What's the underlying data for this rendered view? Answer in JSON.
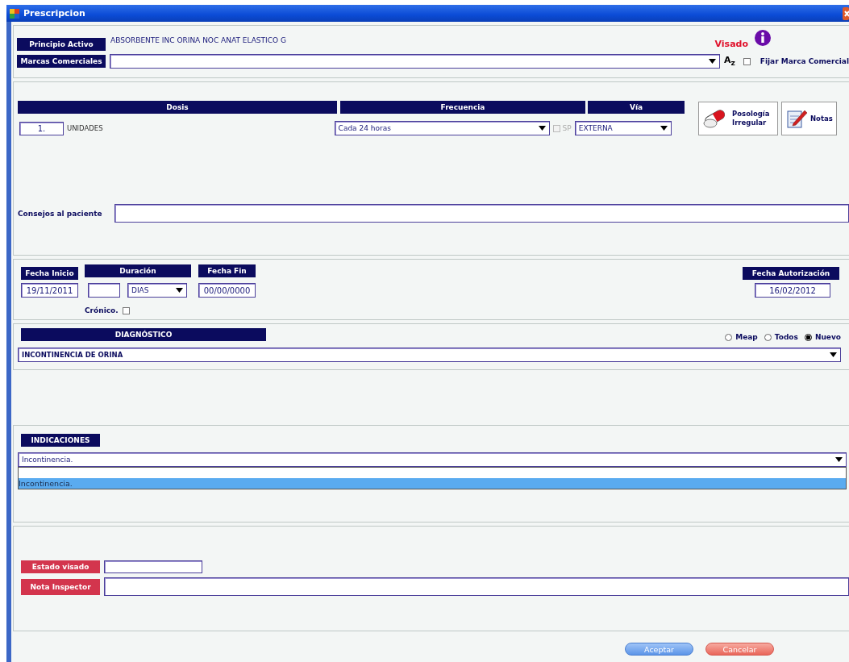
{
  "window": {
    "title": "Prescripcion"
  },
  "principio_activo": {
    "label": "Principio Activo",
    "value": "ABSORBENTE INC ORINA NOC ANAT ELASTICO G"
  },
  "visado": {
    "label": "Visado"
  },
  "marcas_comerciales": {
    "label": "Marcas Comerciales",
    "sort_label": "A$_{z}$",
    "fijar": {
      "label": "Fijar Marca Comercial",
      "checked": false
    }
  },
  "dosis": {
    "header": "Dosis",
    "value": "1.",
    "unit": "UNIDADES"
  },
  "frecuencia": {
    "header": "Frecuencia",
    "value": "Cada 24 horas",
    "sp": {
      "label": "SP",
      "checked": false,
      "disabled": true
    }
  },
  "via": {
    "header": "Vía",
    "value": "EXTERNA"
  },
  "side_buttons": [
    {
      "label": "Posología Irregular",
      "kind": "pills"
    },
    {
      "label": "Notas",
      "kind": "notes"
    }
  ],
  "consejos": {
    "label": "Consejos al paciente"
  },
  "fecha_inicio": {
    "label": "Fecha Inicio",
    "value": "19/11/2011"
  },
  "duracion": {
    "label": "Duración",
    "unit": "DIAS"
  },
  "fecha_fin": {
    "label": "Fecha Fin",
    "value": "00/00/0000"
  },
  "cronico": {
    "label": "Crónico.",
    "checked": false
  },
  "fecha_autorizacion": {
    "label": "Fecha Autorización",
    "value": "16/02/2012"
  },
  "diagnostico": {
    "header": "DIAGNÓSTICO",
    "value": "INCONTINENCIA DE ORINA",
    "options": [
      {
        "label": "Meap",
        "selected": false
      },
      {
        "label": "Todos",
        "selected": false
      },
      {
        "label": "Nuevo",
        "selected": true
      }
    ]
  },
  "indicaciones": {
    "header": "INDICACIONES",
    "value": "Incontinencia.",
    "list": [
      {
        "label": "Incontinencia.",
        "selected": true
      }
    ]
  },
  "estado_visado": {
    "label": "Estado visado"
  },
  "nota_inspector": {
    "label": "Nota Inspector"
  },
  "buttons": [
    {
      "label": "Aceptar",
      "kind": "accept"
    },
    {
      "label": "Cancelar",
      "kind": "cancel"
    }
  ]
}
